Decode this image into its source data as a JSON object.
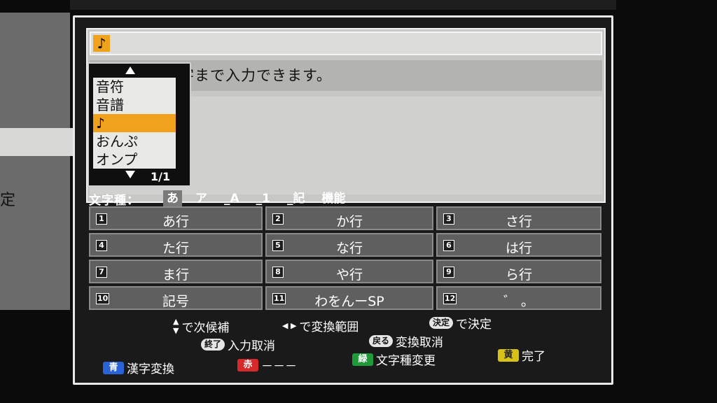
{
  "background": {
    "side_text": "定"
  },
  "input": {
    "value": "♪",
    "message": "字まで入力できます。"
  },
  "candidates": {
    "items": [
      "音符",
      "音譜",
      "♪",
      "おんぷ",
      "オンプ"
    ],
    "selected_index": 2,
    "page": "1/1"
  },
  "char_type": {
    "label": "文字種：",
    "options": [
      "あ",
      "ア",
      "_A",
      "_1",
      "_記",
      "機能"
    ],
    "active_index": 0
  },
  "keys": [
    {
      "num": "1",
      "label": "あ行"
    },
    {
      "num": "2",
      "label": "か行"
    },
    {
      "num": "3",
      "label": "さ行"
    },
    {
      "num": "4",
      "label": "た行"
    },
    {
      "num": "5",
      "label": "な行"
    },
    {
      "num": "6",
      "label": "は行"
    },
    {
      "num": "7",
      "label": "ま行"
    },
    {
      "num": "8",
      "label": "や行"
    },
    {
      "num": "9",
      "label": "ら行"
    },
    {
      "num": "10",
      "label": "記号"
    },
    {
      "num": "11",
      "label": "わをんーSP"
    },
    {
      "num": "12",
      "label": "゛ 。"
    }
  ],
  "help": {
    "next_candidate": "で次候補",
    "change_range": "で変換範囲",
    "decide_pill": "決定",
    "decide_text": "で決定",
    "end_pill": "終了",
    "end_text": "入力取消",
    "back_pill": "戻る",
    "back_text": "変換取消"
  },
  "color_buttons": [
    {
      "key": "青",
      "label": "漢字変換",
      "color": "#2a63d6"
    },
    {
      "key": "赤",
      "label": "－－－",
      "color": "#d62a2a"
    },
    {
      "key": "緑",
      "label": "文字種変更",
      "color": "#1f9a3a"
    },
    {
      "key": "黄",
      "label": "完了",
      "color": "#d8c21a"
    }
  ]
}
